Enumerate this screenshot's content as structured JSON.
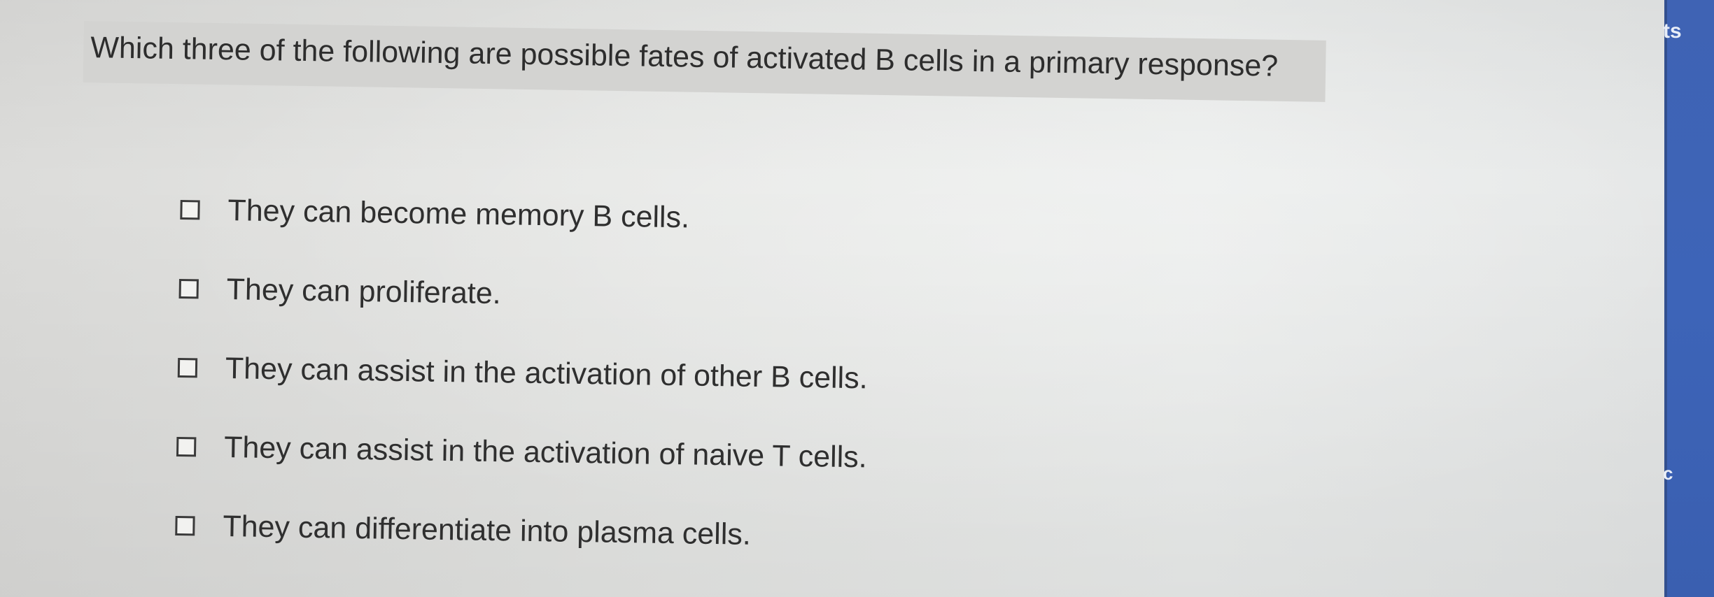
{
  "question": {
    "text": "Which three of the following are possible fates of activated B cells in a primary response?"
  },
  "options": [
    {
      "label": "They can become memory B cells.",
      "checked": false
    },
    {
      "label": "They can proliferate.",
      "checked": false
    },
    {
      "label": "They can assist in the activation of other B cells.",
      "checked": false
    },
    {
      "label": "They can assist in the activation of naive T cells.",
      "checked": false
    },
    {
      "label": "They can differentiate into plasma cells.",
      "checked": false
    }
  ],
  "side_panel": {
    "top_text": "ts",
    "mid_text": "c",
    "color": "#3d64b8"
  }
}
